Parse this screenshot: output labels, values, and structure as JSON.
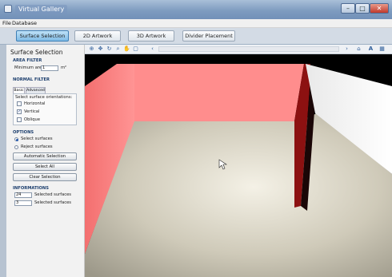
{
  "window": {
    "title": "Virtual Gallery",
    "controls": {
      "minimize": "–",
      "maximize": "□",
      "close": "✕"
    }
  },
  "menu": {
    "file": "File",
    "database": "Database"
  },
  "tabs": [
    {
      "label": "Surface Selection",
      "active": true
    },
    {
      "label": "2D Artwork"
    },
    {
      "label": "3D Artwork"
    },
    {
      "label": "Divider Placement"
    }
  ],
  "panel": {
    "title": "Surface Selection",
    "area_filter": {
      "heading": "AREA FILTER",
      "min_area_label": "Minimum area:",
      "min_area_value": "1",
      "unit": "m²"
    },
    "normal_filter": {
      "heading": "NORMAL FILTER",
      "tabs": [
        "Basic",
        "Advanced"
      ],
      "prompt": "Select surface orientations:",
      "options": [
        {
          "label": "Horizontal",
          "checked": false
        },
        {
          "label": "Vertical",
          "checked": true
        },
        {
          "label": "Oblique",
          "checked": false
        }
      ]
    },
    "options": {
      "heading": "OPTIONS",
      "select_surfaces": "Select surfaces",
      "reject_surfaces": "Reject surfaces",
      "automatic_selection": "Automatic Selection",
      "select_all": "Select All",
      "clear_selection": "Clear Selection"
    },
    "informations": {
      "heading": "INFORMATIONS",
      "rows": [
        {
          "value": "24",
          "label": "Selected surfaces"
        },
        {
          "value": "3",
          "label": "Selected surfaces"
        }
      ]
    }
  },
  "viewport_toolbar": {
    "icons": [
      "select-icon",
      "move-icon",
      "rotate-icon",
      "zoom-icon",
      "pan-icon",
      "fit-icon",
      "scroll-left-icon",
      "scroll-right-icon",
      "camera-icon",
      "text-icon",
      "grid-icon"
    ]
  },
  "colors": {
    "accent_tab": "#7fbbe6",
    "selected_wall": "#ff8a8a",
    "divider_wall": "#8a1010",
    "floor": "#cbc7b8",
    "white_wall": "#f7f7f7"
  }
}
